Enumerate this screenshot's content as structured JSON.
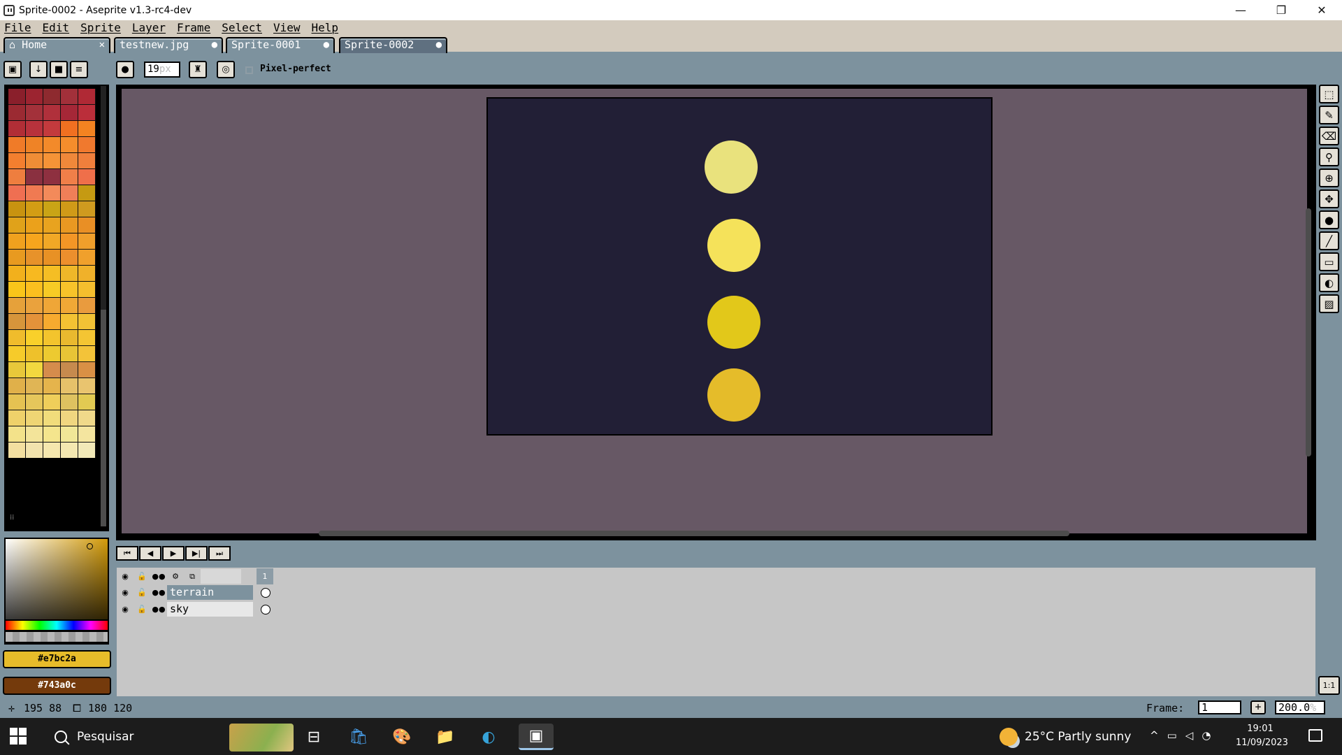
{
  "window": {
    "title": "Sprite-0002 - Aseprite v1.3-rc4-dev",
    "minimize": "—",
    "maximize": "❐",
    "close": "✕"
  },
  "menu": [
    "File",
    "Edit",
    "Sprite",
    "Layer",
    "Frame",
    "Select",
    "View",
    "Help"
  ],
  "tabs": [
    {
      "label": "Home",
      "icon": "home-icon",
      "marker": "✕"
    },
    {
      "label": "testnew.jpg",
      "marker": "●"
    },
    {
      "label": "Sprite-0001",
      "marker": "●"
    },
    {
      "label": "Sprite-0002",
      "marker": "●",
      "active": true
    }
  ],
  "toolbar": {
    "brush_size": "19",
    "brush_unit": "px",
    "pixel_perfect_label": "Pixel-perfect",
    "pixel_perfect_checked": false
  },
  "palette_colors": [
    "#8a1f2b",
    "#9c2430",
    "#8e2a2f",
    "#a2303a",
    "#b02935",
    "#9b2a32",
    "#a3313a",
    "#b0303b",
    "#a52737",
    "#bb2e3a",
    "#b12e36",
    "#b8323c",
    "#c33a3d",
    "#f07021",
    "#f38321",
    "#f07b28",
    "#ef8326",
    "#f38a2a",
    "#f58d2c",
    "#f0792e",
    "#f37f2f",
    "#ef8d36",
    "#f59337",
    "#f0883a",
    "#f07f3c",
    "#ee7e3f",
    "#8a3040",
    "#8e3040",
    "#f07f49",
    "#ef6f4a",
    "#ef6f52",
    "#f07a52",
    "#f38a5a",
    "#ef7f58",
    "#c59a12",
    "#c89310",
    "#d39d14",
    "#c9a416",
    "#d09a18",
    "#cf9a1f",
    "#e0a21a",
    "#eba11b",
    "#e8a31f",
    "#e99822",
    "#e98f25",
    "#f0a11e",
    "#f7a51d",
    "#f1a826",
    "#f39626",
    "#f09f2b",
    "#e89a20",
    "#e7922a",
    "#e89125",
    "#ec8f2d",
    "#f0a02c",
    "#f2b01c",
    "#f7b920",
    "#f5be24",
    "#efb729",
    "#f0b12a",
    "#f9c51a",
    "#fbbf1f",
    "#f7cb25",
    "#f8c32a",
    "#f5be2e",
    "#e6a13a",
    "#eaa23d",
    "#efa637",
    "#f0a836",
    "#e99b3e",
    "#d6953b",
    "#e4923a",
    "#f7aa2f",
    "#f4c233",
    "#f2c235",
    "#f0bc2c",
    "#f9d02a",
    "#f3c42d",
    "#e9b92f",
    "#f4c533",
    "#f6cb2a",
    "#eec12b",
    "#edca30",
    "#e8c436",
    "#f3c339",
    "#e8c83a",
    "#f2d83f",
    "#d58c4c",
    "#c68a4e",
    "#d99045",
    "#e0b04a",
    "#e0b555",
    "#e5b44c",
    "#e6c16a",
    "#e9c46f",
    "#e5c252",
    "#e5c65b",
    "#efce5a",
    "#dec260",
    "#e2ca52",
    "#efd16a",
    "#efd574",
    "#f1dc7b",
    "#f0d680",
    "#f0d98a",
    "#f3e28a",
    "#f3e49a",
    "#f4e58d",
    "#f1e797",
    "#f4e59f",
    "#f3dfa0",
    "#f2e3ad",
    "#f5e7ae",
    "#f4e8b1",
    "#f2e9b8"
  ],
  "colors": {
    "foreground": "#e7bc2a",
    "background": "#743a0c"
  },
  "timeline_buttons": [
    "⏮",
    "◀",
    "▶",
    "▶|",
    "⏭"
  ],
  "layers": {
    "frame_number": "1",
    "rows": [
      {
        "name": "terrain",
        "selected": true
      },
      {
        "name": "sky",
        "selected": false
      }
    ]
  },
  "status": {
    "cursor_pos": "195 88",
    "sprite_size": "180 120",
    "frame_label": "Frame:",
    "frame_value": "1",
    "zoom_value": "200.0",
    "zoom_unit": "%"
  },
  "sprite_dots": [
    {
      "color": "#e9e27d"
    },
    {
      "color": "#f5e25a"
    },
    {
      "color": "#e2c81a"
    },
    {
      "color": "#e5bc2a"
    }
  ],
  "taskbar": {
    "search_placeholder": "Pesquisar",
    "weather": "25°C  Partly sunny",
    "time": "19:01",
    "date": "11/09/2023"
  }
}
